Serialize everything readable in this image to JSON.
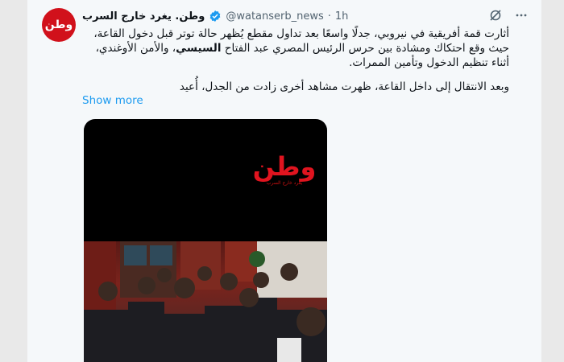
{
  "tweet": {
    "avatar_label": "وطن",
    "display_name": "وطن. يغرد خارج السرب",
    "handle": "@watanserb_news",
    "separator": "·",
    "time": "1h",
    "para1_a": "أثارت قمة أفريقية في نيروبي، جدلًا واسعًا بعد تداول مقطع يُظهر حالة توتر قبل دخول القاعة، حيث وقع احتكاك ومشادة بين حرس الرئيس المصري عبد الفتاح ",
    "para1_bold": "السيسي",
    "para1_b": "، والأمن الأوغندي، أثناء تنظيم الدخول وتأمين الممرات.",
    "para2": "وبعد الانتقال إلى داخل القاعة، ظهرت مشاهد أخرى زادت من الجدل، أُعيد",
    "show_more": "Show more"
  },
  "media": {
    "logo_text": "وطن",
    "logo_subtext": "يغرد خارج السرب"
  },
  "icons": {
    "grok": "grok-icon",
    "more": "more-icon",
    "verified": "verified-badge-icon"
  },
  "colors": {
    "accent": "#1d9bf0",
    "brand_red": "#e0141f"
  }
}
